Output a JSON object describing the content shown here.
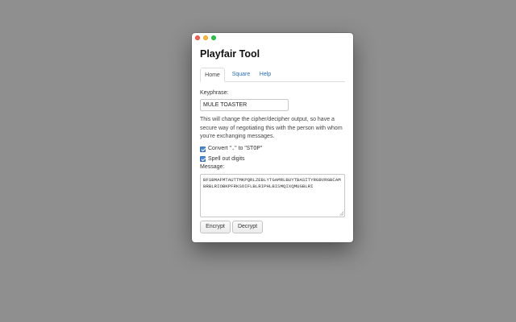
{
  "window": {
    "title": "Playfair Tool"
  },
  "tabs": [
    {
      "label": "Home"
    },
    {
      "label": "Square"
    },
    {
      "label": "Help"
    }
  ],
  "keyphrase": {
    "label": "Keyphrase:",
    "value": "MULE TOASTER"
  },
  "help_text": "This will change the cipher/decipher output, so have a secure way of negotiating this with the person with whom you're exchanging messages.",
  "options": {
    "convert_period": {
      "prefix": "Convert \"",
      "code1": ".",
      "middle": "\" to \"",
      "code2": "STOP",
      "suffix": "\"",
      "checked": true
    },
    "spell_digits": {
      "label": "Spell out digits",
      "checked": true
    }
  },
  "message": {
    "label": "Message:",
    "value": "BFSBMAFMTAUTTMKPQRLZEBLYTGAMRLBUYTBASITYRGBVRGBCAMBRBLRIOBKPFRKSOIFLBLRIPHLBISMQIXQMUGBLRI"
  },
  "buttons": {
    "encrypt": "Encrypt",
    "decrypt": "Decrypt"
  },
  "colors": {
    "background": "#8f8f8f",
    "link": "#2a6fbf",
    "checkbox": "#4a89dc"
  }
}
